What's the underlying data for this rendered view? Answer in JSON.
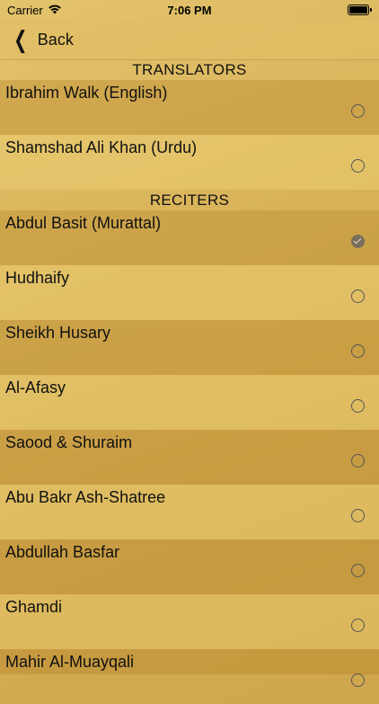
{
  "status": {
    "carrier": "Carrier",
    "time": "7:06 PM"
  },
  "nav": {
    "back_label": "Back"
  },
  "sections": {
    "translators": {
      "title": "TRANSLATORS",
      "items": [
        {
          "label": "Ibrahim Walk (English)",
          "selected": false
        },
        {
          "label": "Shamshad Ali Khan (Urdu)",
          "selected": false
        }
      ]
    },
    "reciters": {
      "title": "RECITERS",
      "items": [
        {
          "label": "Abdul Basit (Murattal)",
          "selected": true
        },
        {
          "label": "Hudhaify",
          "selected": false
        },
        {
          "label": "Sheikh Husary",
          "selected": false
        },
        {
          "label": "Al-Afasy",
          "selected": false
        },
        {
          "label": "Saood & Shuraim",
          "selected": false
        },
        {
          "label": "Abu Bakr Ash-Shatree",
          "selected": false
        },
        {
          "label": "Abdullah Basfar",
          "selected": false
        },
        {
          "label": "Ghamdi",
          "selected": false
        },
        {
          "label": "Mahir Al-Muayqali",
          "selected": false
        }
      ]
    }
  },
  "colors": {
    "accent_gold": "#d9b45a",
    "check_gray": "#7a6f5c"
  }
}
